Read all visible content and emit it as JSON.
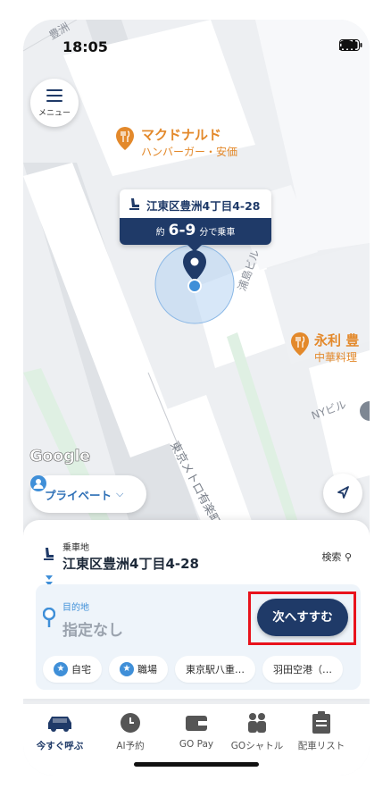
{
  "status_bar": {
    "time": "18:05"
  },
  "menu": {
    "label": "メニュー"
  },
  "map": {
    "poi_mcdonalds": {
      "name": "マクドナルド",
      "sub": "ハンバーガー・安価"
    },
    "poi_eiri": {
      "name": "永利 豊",
      "sub": "中華料理"
    },
    "building_label_1": "浦島ビル",
    "building_label_2": "NYビル",
    "street_label": "東京メトロ有楽町",
    "district_label": "豊洲",
    "google_logo": "Google"
  },
  "pickup_bubble": {
    "address": "江東区豊洲4丁目4-28",
    "eta_prefix": "約",
    "eta_value": "6-9",
    "eta_suffix": "分で乗車"
  },
  "profile_button": {
    "label": "プライベート"
  },
  "sheet": {
    "pickup": {
      "caption": "乗車地",
      "address": "江東区豊洲4丁目4-28",
      "search_label": "検索"
    },
    "destination": {
      "caption": "目的地",
      "value": "指定なし"
    },
    "next_button": "次へすすむ",
    "shortcuts": [
      {
        "label": "自宅"
      },
      {
        "label": "職場"
      },
      {
        "label": "東京駅八重…"
      },
      {
        "label": "羽田空港（…"
      }
    ]
  },
  "tabs": [
    {
      "label": "今すぐ呼ぶ",
      "icon": "car-icon"
    },
    {
      "label": "AI予約",
      "icon": "clock-icon"
    },
    {
      "label": "GO Pay",
      "icon": "wallet-icon"
    },
    {
      "label": "GOシャトル",
      "icon": "shuttle-people-icon"
    },
    {
      "label": "配車リスト",
      "icon": "clipboard-icon"
    }
  ],
  "colors": {
    "accent": "#1f3a68",
    "blue": "#3f8fd8",
    "poi": "#e3892b",
    "highlight": "#e8121c"
  }
}
